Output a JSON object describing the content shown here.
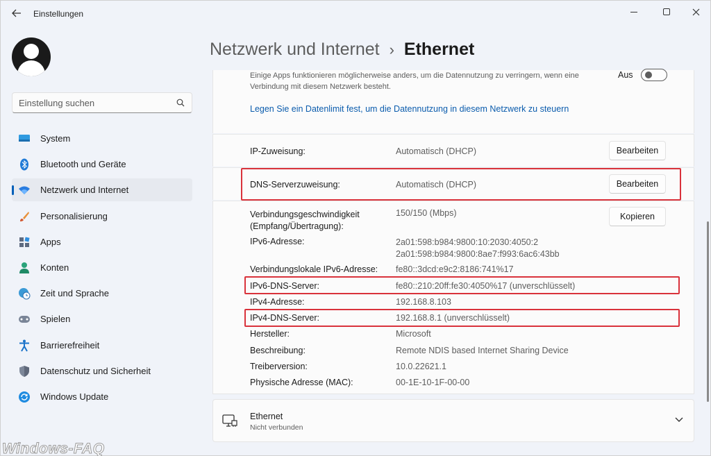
{
  "window": {
    "title": "Einstellungen",
    "back_icon": "arrow-left-icon",
    "controls": [
      "minimize-icon",
      "maximize-icon",
      "close-icon"
    ]
  },
  "sidebar": {
    "search": {
      "placeholder": "Einstellung suchen",
      "icon": "search-icon"
    },
    "items": [
      {
        "label": "System",
        "icon": "monitor-icon"
      },
      {
        "label": "Bluetooth und Geräte",
        "icon": "bluetooth-icon"
      },
      {
        "label": "Netzwerk und Internet",
        "icon": "wifi-icon",
        "active": true
      },
      {
        "label": "Personalisierung",
        "icon": "brush-icon"
      },
      {
        "label": "Apps",
        "icon": "apps-icon"
      },
      {
        "label": "Konten",
        "icon": "person-icon"
      },
      {
        "label": "Zeit und Sprache",
        "icon": "globe-clock-icon"
      },
      {
        "label": "Spielen",
        "icon": "gamepad-icon"
      },
      {
        "label": "Barrierefreiheit",
        "icon": "accessibility-icon"
      },
      {
        "label": "Datenschutz und Sicherheit",
        "icon": "shield-icon"
      },
      {
        "label": "Windows Update",
        "icon": "update-icon"
      }
    ]
  },
  "header": {
    "parent": "Netzwerk und Internet",
    "separator": "›",
    "current": "Ethernet"
  },
  "metered": {
    "description": "Einige Apps funktionieren möglicherweise anders, um die Datennutzung zu verringern, wenn eine Verbindung mit diesem Netzwerk besteht.",
    "toggle_label": "Aus",
    "toggle_on": false,
    "data_limit_link": "Legen Sie ein Datenlimit fest, um die Datennutzung in diesem Netzwerk zu steuern"
  },
  "ip_assignment": {
    "label": "IP-Zuweisung:",
    "value": "Automatisch (DHCP)",
    "button": "Bearbeiten"
  },
  "dns_assignment": {
    "label": "DNS-Serverzuweisung:",
    "value": "Automatisch (DHCP)",
    "button": "Bearbeiten"
  },
  "properties": {
    "copy_button": "Kopieren",
    "rows": [
      {
        "label": "Verbindungsgeschwindigkeit (Empfang/Übertragung):",
        "value": "150/150 (Mbps)"
      },
      {
        "label": "IPv6-Adresse:",
        "value": "2a01:598:b984:9800:10:2030:4050:2",
        "value2": "2a01:598:b984:9800:8ae7:f993:6ac6:43bb"
      },
      {
        "label": "Verbindungslokale IPv6-Adresse:",
        "value": "fe80::3dcd:e9c2:8186:741%17"
      },
      {
        "label": "IPv6-DNS-Server:",
        "value": "fe80::210:20ff:fe30:4050%17 (unverschlüsselt)"
      },
      {
        "label": "IPv4-Adresse:",
        "value": "192.168.8.103"
      },
      {
        "label": "IPv4-DNS-Server:",
        "value": "192.168.8.1 (unverschlüsselt)"
      },
      {
        "label": "Hersteller:",
        "value": "Microsoft"
      },
      {
        "label": "Beschreibung:",
        "value": "Remote NDIS based Internet Sharing Device"
      },
      {
        "label": "Treiberversion:",
        "value": "10.0.22621.1"
      },
      {
        "label": "Physische Adresse (MAC):",
        "value": "00-1E-10-1F-00-00"
      }
    ]
  },
  "ethernet_adapter": {
    "title": "Ethernet",
    "status": "Nicht verbunden",
    "icon": "ethernet-monitor-icon",
    "chevron": "chevron-down-icon"
  },
  "highlight_color": "#d9323b",
  "accent_color": "#005fb8",
  "watermark": "Windows-FAQ"
}
